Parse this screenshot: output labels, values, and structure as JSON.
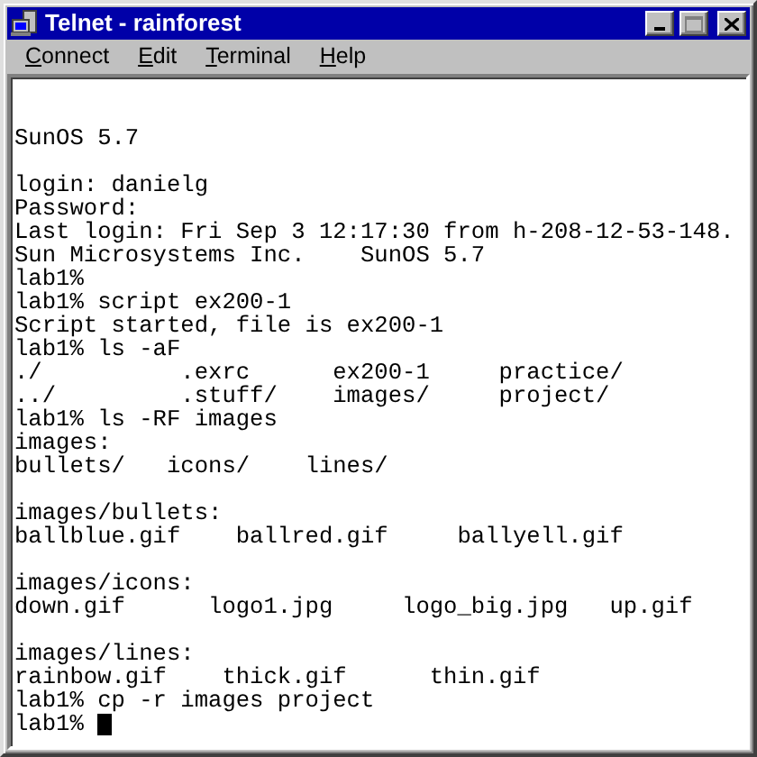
{
  "window": {
    "title": "Telnet - rainforest"
  },
  "menu": [
    "Connect",
    "Edit",
    "Terminal",
    "Help"
  ],
  "terminal": {
    "lines": [
      {
        "kind": "blank"
      },
      {
        "kind": "blank"
      },
      {
        "kind": "text",
        "text": "SunOS 5.7"
      },
      {
        "kind": "blank"
      },
      {
        "kind": "text",
        "text": "login: danielg"
      },
      {
        "kind": "text",
        "text": "Password:"
      },
      {
        "kind": "text",
        "text": "Last login: Fri Sep 3 12:17:30 from h-208-12-53-148."
      },
      {
        "kind": "text",
        "text": "Sun Microsystems Inc.    SunOS 5.7"
      },
      {
        "kind": "text",
        "text": "lab1%"
      },
      {
        "kind": "text",
        "text": "lab1% script ex200-1"
      },
      {
        "kind": "text",
        "text": "Script started, file is ex200-1"
      },
      {
        "kind": "text",
        "text": "lab1% ls -aF"
      },
      {
        "kind": "text",
        "text": "./          .exrc      ex200-1     practice/"
      },
      {
        "kind": "text",
        "text": "../         .stuff/    images/     project/"
      },
      {
        "kind": "text",
        "text": "lab1% ls -RF images"
      },
      {
        "kind": "text",
        "text": "images:"
      },
      {
        "kind": "text",
        "text": "bullets/   icons/    lines/"
      },
      {
        "kind": "blank"
      },
      {
        "kind": "text",
        "text": "images/bullets:"
      },
      {
        "kind": "text",
        "text": "ballblue.gif    ballred.gif     ballyell.gif"
      },
      {
        "kind": "blank"
      },
      {
        "kind": "text",
        "text": "images/icons:"
      },
      {
        "kind": "text",
        "text": "down.gif      logo1.jpg     logo_big.jpg   up.gif"
      },
      {
        "kind": "blank"
      },
      {
        "kind": "text",
        "text": "images/lines:"
      },
      {
        "kind": "text",
        "text": "rainbow.gif    thick.gif      thin.gif"
      },
      {
        "kind": "text",
        "text": "lab1% cp -r images project"
      },
      {
        "kind": "prompt",
        "text": "lab1%",
        "cursor": true
      }
    ]
  }
}
